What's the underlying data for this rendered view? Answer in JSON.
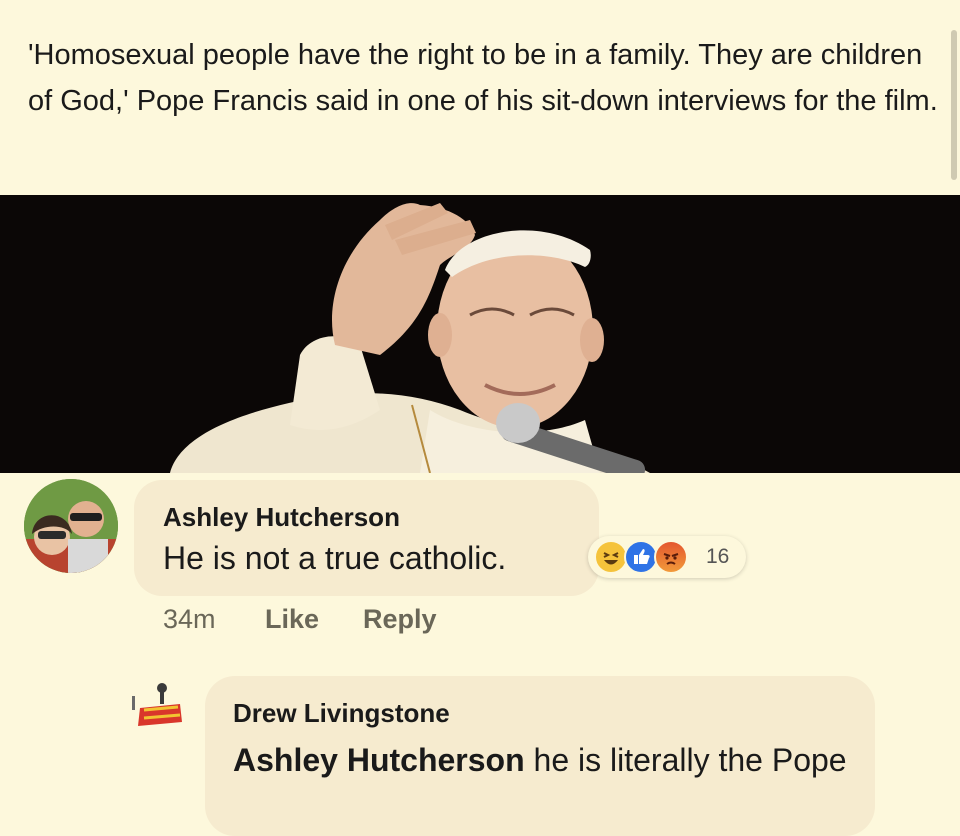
{
  "post": {
    "caption": "'Homosexual people have the right to be in a family. They are children of God,' Pope Francis said in one of his sit-down interviews for the film."
  },
  "comments": [
    {
      "author": "Ashley Hutcherson",
      "text": "He is not a true catholic.",
      "time": "34m",
      "like_label": "Like",
      "reply_label": "Reply",
      "reactions": [
        "haha-icon",
        "like-icon",
        "angry-icon"
      ],
      "reaction_count": "16"
    },
    {
      "author": "Drew Livingstone",
      "mention": "Ashley Hutcherson",
      "text": " he is literally the Pope"
    }
  ]
}
